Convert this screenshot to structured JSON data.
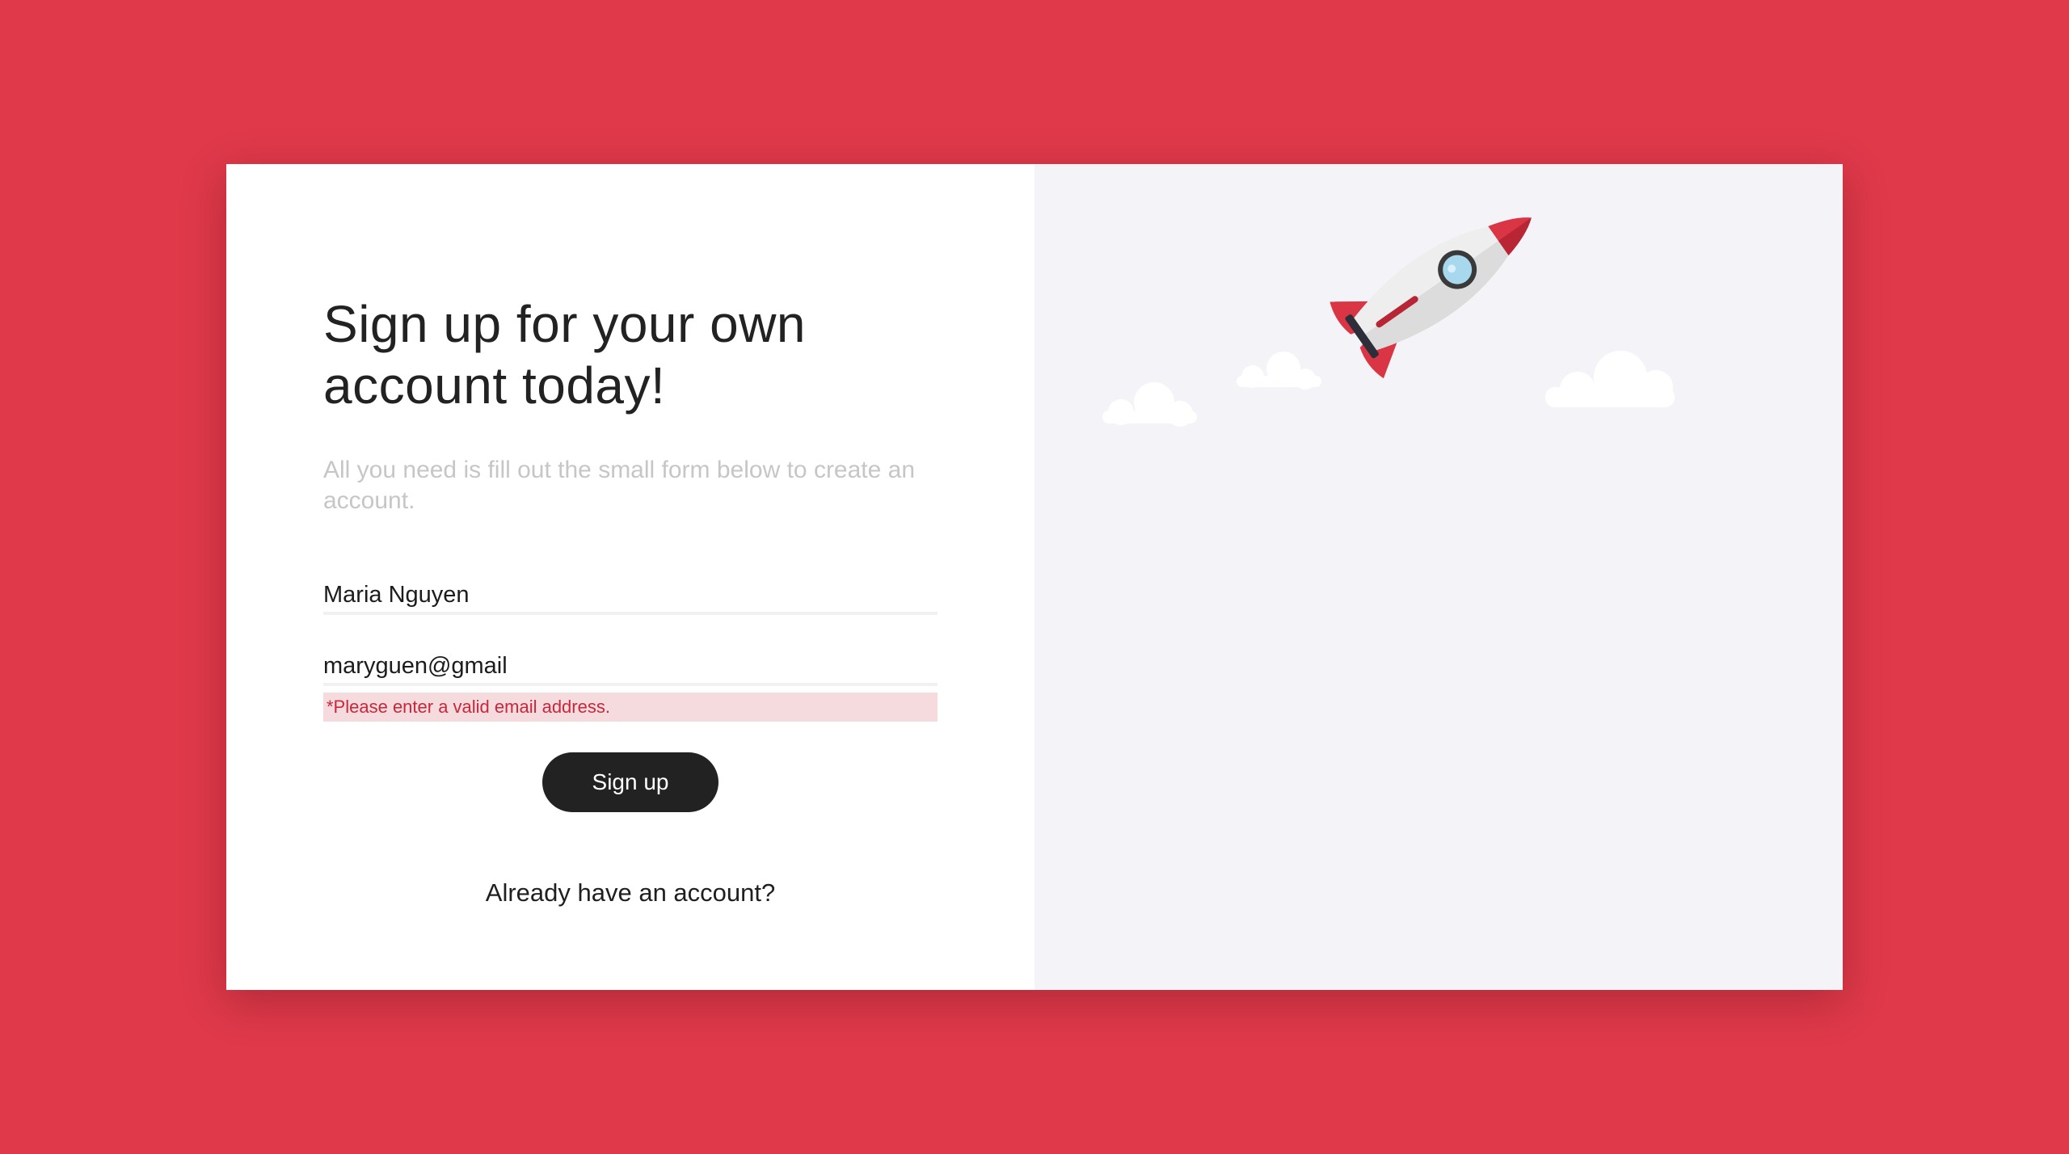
{
  "form": {
    "title": "Sign up for your own account today!",
    "subtitle": "All you need is fill out the small form below to create an account.",
    "name_value": "Maria Nguyen",
    "email_value": "maryguen@gmail",
    "email_error": "*Please enter a valid email address.",
    "submit_label": "Sign up",
    "login_link_label": "Already have an account?"
  },
  "illustration": {
    "icon": "rocket-icon",
    "clouds": [
      "cloud-icon",
      "cloud-icon",
      "cloud-icon"
    ]
  },
  "colors": {
    "background": "#df394a",
    "accent": "#df394a",
    "button": "#222222",
    "error_text": "#c8283a",
    "error_background": "#f5dade",
    "right_panel": "#f4f4f8"
  }
}
